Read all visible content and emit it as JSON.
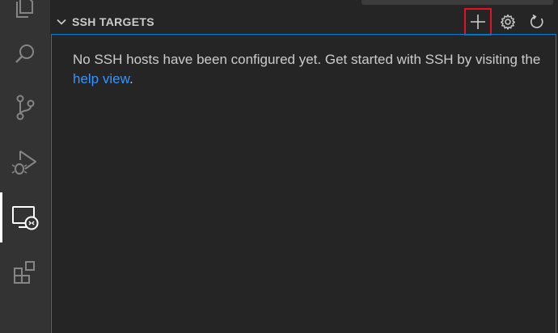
{
  "section": {
    "title": "SSH TARGETS"
  },
  "welcome": {
    "text_before_link": "No SSH hosts have been configured yet. Get started with SSH by visiting the ",
    "link_text": "help view",
    "text_after_link": "."
  },
  "activity_bar": {
    "items": [
      {
        "icon": "explorer-icon"
      },
      {
        "icon": "search-icon"
      },
      {
        "icon": "source-control-icon"
      },
      {
        "icon": "run-debug-icon"
      },
      {
        "icon": "remote-explorer-icon",
        "active": true
      },
      {
        "icon": "extensions-icon"
      }
    ]
  },
  "header_actions": [
    {
      "icon": "add-icon",
      "highlighted": true
    },
    {
      "icon": "gear-icon"
    },
    {
      "icon": "refresh-icon"
    }
  ],
  "colors": {
    "activity_bar_bg": "#333333",
    "sidebar_bg": "#252526",
    "focus_border": "#007fd4",
    "link": "#3794ff",
    "highlight_box": "#e81123",
    "text": "#cccccc"
  }
}
